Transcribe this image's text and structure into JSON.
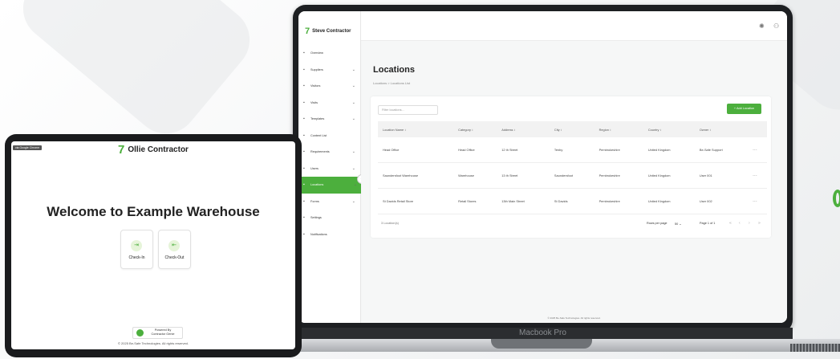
{
  "laptop": {
    "brand": "Macbook Pro",
    "app": {
      "logo_text": "Steve Contractor",
      "nav": [
        {
          "label": "Overview",
          "icon": "grid-icon",
          "chevron": ""
        },
        {
          "label": "Suppliers",
          "icon": "truck-icon",
          "chevron": "⌄"
        },
        {
          "label": "Visitors",
          "icon": "users-icon",
          "chevron": "⌄"
        },
        {
          "label": "Visits",
          "icon": "clock-icon",
          "chevron": "⌄"
        },
        {
          "label": "Templates",
          "icon": "template-icon",
          "chevron": "⌄"
        },
        {
          "label": "Content List",
          "icon": "list-icon",
          "chevron": ""
        },
        {
          "label": "Requirements",
          "icon": "requirements-icon",
          "chevron": "⌄"
        },
        {
          "label": "Users",
          "icon": "user-icon",
          "chevron": "⌄"
        },
        {
          "label": "Locations",
          "icon": "location-icon",
          "chevron": "⌄"
        },
        {
          "label": "Forms",
          "icon": "form-icon",
          "chevron": "⌄"
        },
        {
          "label": "Settings",
          "icon": "gear-icon",
          "chevron": ""
        },
        {
          "label": "Notifications",
          "icon": "bell-icon",
          "chevron": ""
        }
      ],
      "active_nav": "Locations",
      "page_title": "Locations",
      "breadcrumb": "Locations  >  Locations List",
      "filter_placeholder": "Filter locations...",
      "add_button": "+ Add Location",
      "columns": [
        "Location Name ↕",
        "Category ↕",
        "Address ↕",
        "City ↕",
        "Region ↕",
        "Country ↕",
        "Owner ↕",
        ""
      ],
      "rows": [
        [
          "Head Office",
          "Head Office",
          "12 th Street",
          "Tenby",
          "Pembrokeshire",
          "United Kingdom",
          "Be-Safe Support",
          "···"
        ],
        [
          "Saundersfoot Warehouse",
          "Warehouse",
          "13 th Street",
          "Saundersfoot",
          "Pembrokeshire",
          "United Kingdom",
          "User 001",
          "···"
        ],
        [
          "St Davids Retail Store",
          "Retail Stores",
          "13th Main Street",
          "St Davids",
          "Pembrokeshire",
          "United Kingdom",
          "User 002",
          "···"
        ]
      ],
      "row_count": "3 Location(s)",
      "rows_per_page_label": "Rows per page",
      "rows_per_page_value": "50  ⌄",
      "page_indicator": "Page 1 of 1",
      "pager": [
        "«",
        "‹",
        "›",
        "»"
      ],
      "footer": "© 2025 Be-Safe Technologies. All rights reserved."
    }
  },
  "tablet": {
    "browser_tag": "via Google Chrome",
    "logo_text": "Ollie Contractor",
    "welcome": "Welcome to Example Warehouse",
    "checkin_label": "Check-In",
    "checkout_label": "Check-Out",
    "powered_line1": "Powered By",
    "powered_line2": "Contractor Genie",
    "copyright": "© 2025 Be-Safe Technologies. All rights reserved."
  },
  "colors": {
    "accent": "#4caf3d",
    "device": "#1d1f22"
  }
}
